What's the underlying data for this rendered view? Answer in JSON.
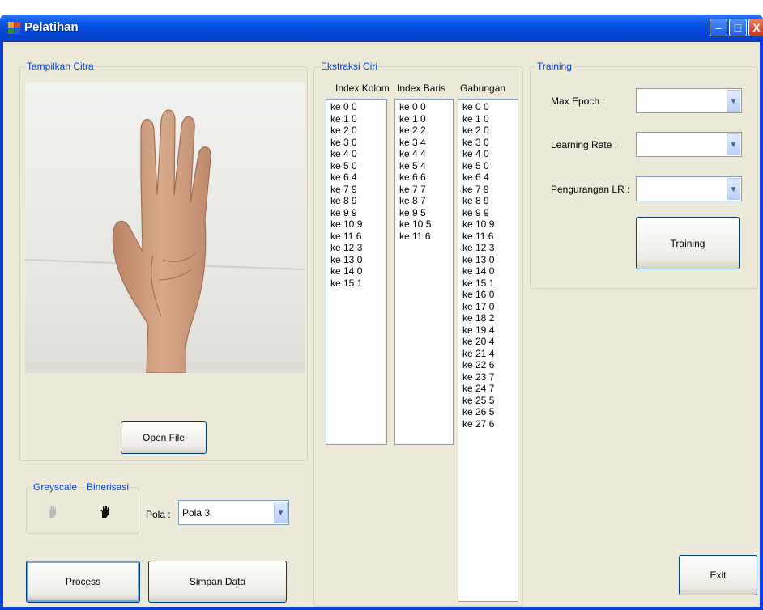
{
  "window": {
    "title": "Pelatihan",
    "minimize_glyph": "–",
    "maximize_glyph": "□",
    "close_glyph": "X"
  },
  "image_group": {
    "title": "Tampilkan Citra",
    "open_file_label": "Open File"
  },
  "mode_group": {
    "greyscale_label": "Greyscale",
    "binerisasi_label": "Binerisasi"
  },
  "pola": {
    "label": "Pola :",
    "selected": "Pola 3"
  },
  "actions": {
    "process_label": "Process",
    "simpan_label": "Simpan Data",
    "exit_label": "Exit"
  },
  "ekstraksi": {
    "title": "Ekstraksi Ciri",
    "kolom_header": "Index Kolom",
    "baris_header": "Index Baris",
    "gabungan_header": "Gabungan",
    "kolom_items": [
      "ke 0 0",
      "ke 1 0",
      "ke 2 0",
      "ke 3 0",
      "ke 4 0",
      "ke 5 0",
      "ke 6 4",
      "ke 7 9",
      "ke 8 9",
      "ke 9 9",
      "ke 10 9",
      "ke 11 6",
      "ke 12 3",
      "ke 13 0",
      "ke 14 0",
      "ke 15 1"
    ],
    "baris_items": [
      "ke 0 0",
      "ke 1 0",
      "ke 2 2",
      "ke 3 4",
      "ke 4 4",
      "ke 5 4",
      "ke 6 6",
      "ke 7 7",
      "ke 8 7",
      "ke 9 5",
      "ke 10 5",
      "ke 11 6"
    ],
    "gabungan_items": [
      "ke 0 0",
      "ke 1 0",
      "ke 2 0",
      "ke 3 0",
      "ke 4 0",
      "ke 5 0",
      "ke 6 4",
      "ke 7 9",
      "ke 8 9",
      "ke 9 9",
      "ke 10 9",
      "ke 11 6",
      "ke 12 3",
      "ke 13 0",
      "ke 14 0",
      "ke 15 1",
      "ke 16 0",
      "ke 17 0",
      "ke 18 2",
      "ke 19 4",
      "ke 20 4",
      "ke 21 4",
      "ke 22 6",
      "ke 23 7",
      "ke 24 7",
      "ke 25 5",
      "ke 26 5",
      "ke 27 6"
    ]
  },
  "training": {
    "title": "Training",
    "max_epoch_label": "Max Epoch :",
    "learning_rate_label": "Learning Rate :",
    "pengurangan_label": "Pengurangan LR :",
    "max_epoch_value": "",
    "learning_rate_value": "",
    "pengurangan_value": "",
    "button_label": "Training"
  },
  "colors": {
    "titlebar": "#0b56e6",
    "form_bg": "#ece9d8",
    "group_title": "#0046d5"
  },
  "icons": [
    "app-window-icon",
    "minimize-icon",
    "maximize-icon",
    "close-icon",
    "combo-arrow-icon",
    "greyscale-hand-icon",
    "binary-hand-icon"
  ]
}
